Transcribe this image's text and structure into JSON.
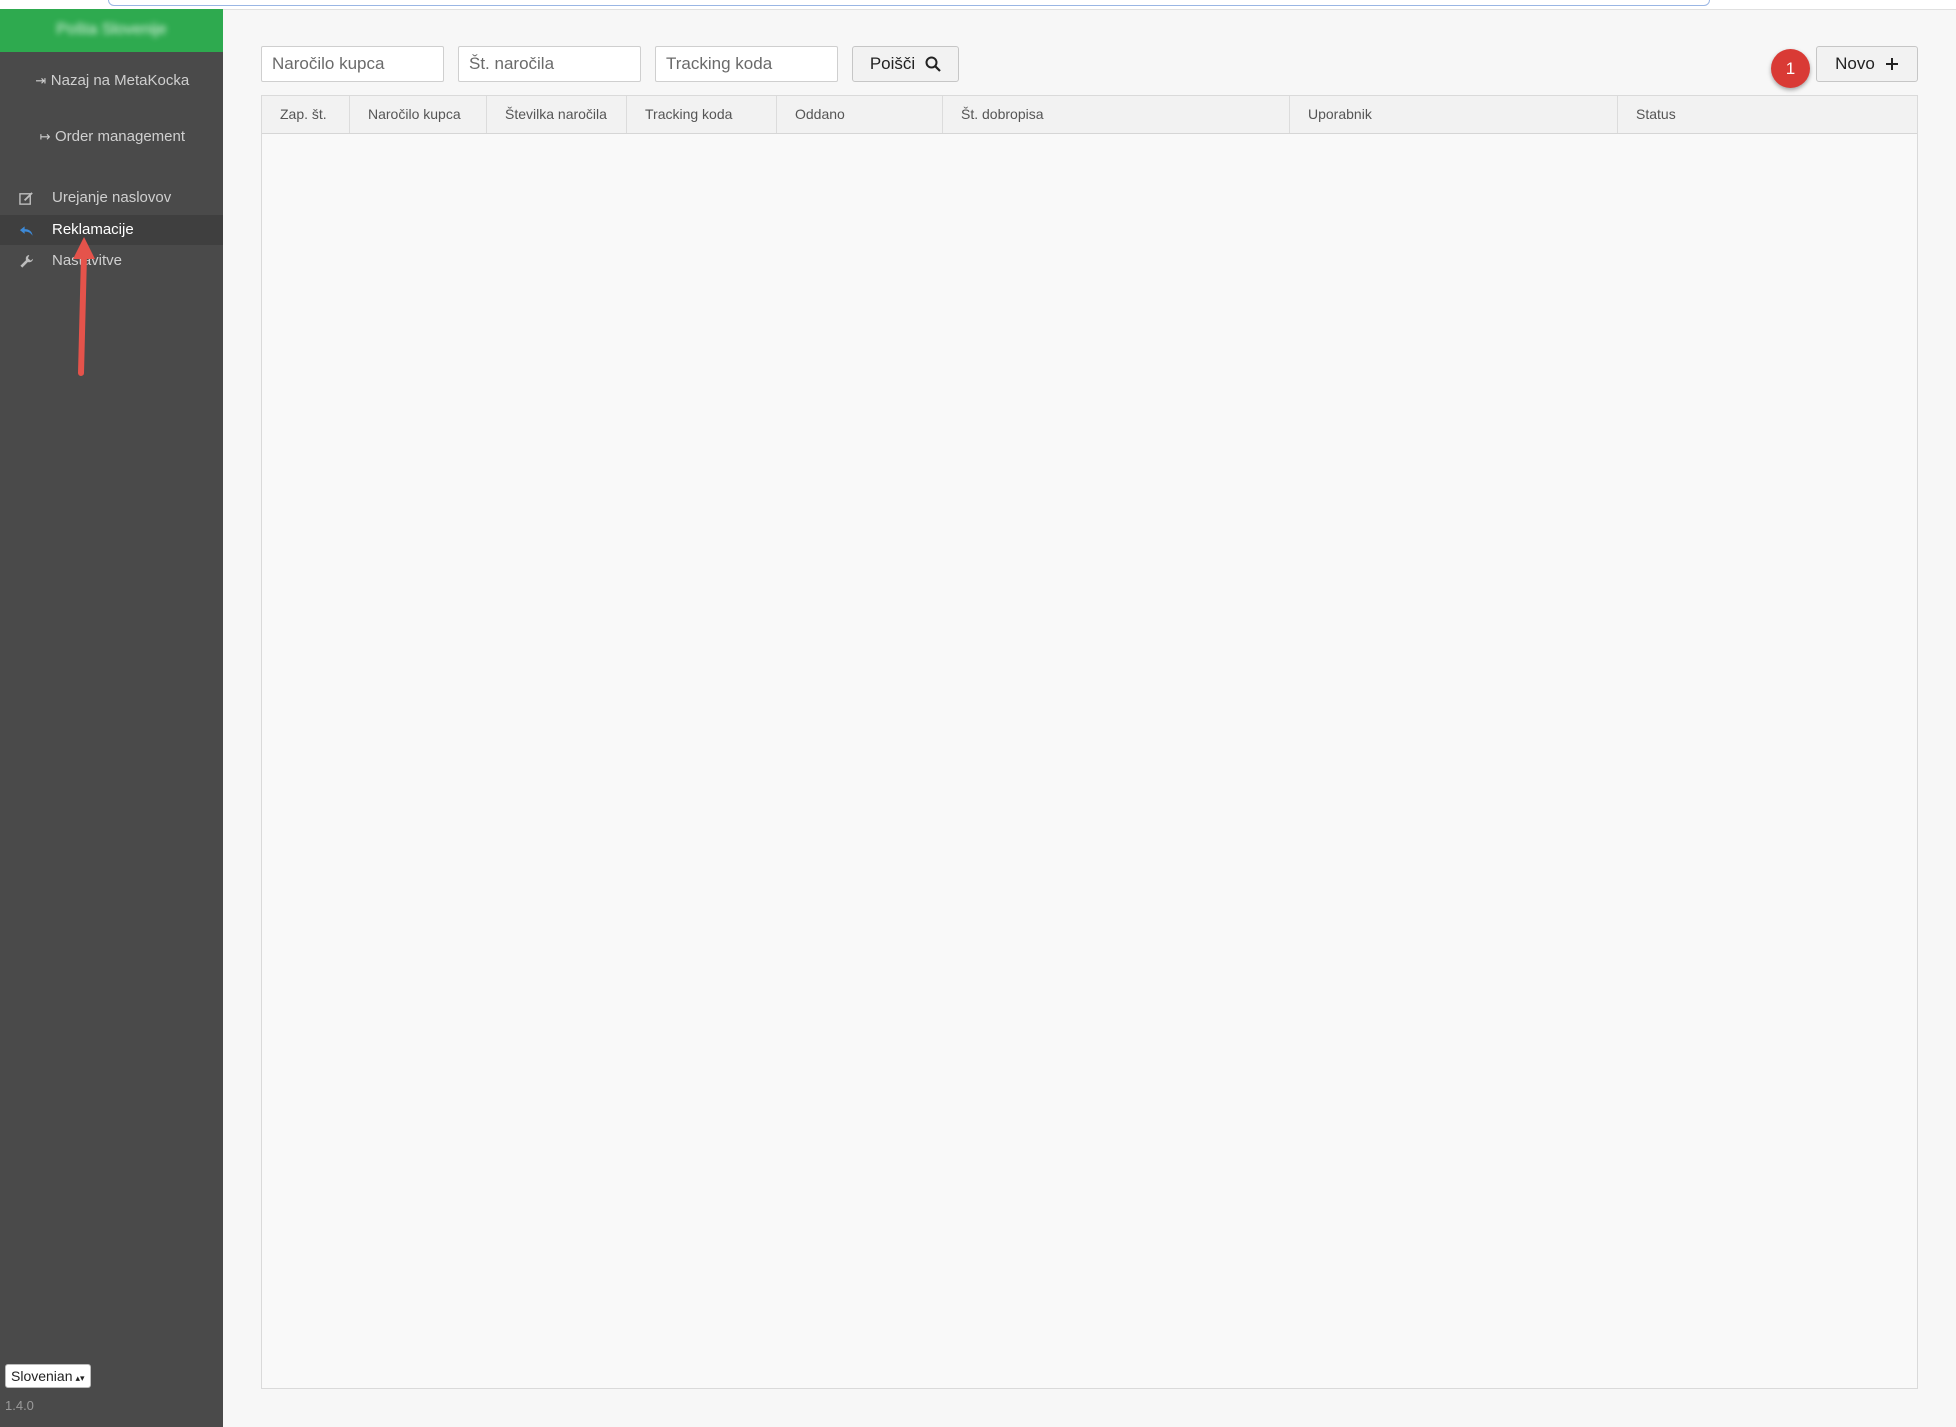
{
  "sidebar": {
    "brand": "Pošta Slovenije",
    "back_link": "Nazaj na MetaKocka",
    "order_link": "Order management",
    "items": [
      {
        "label": "Urejanje naslovov",
        "icon": "edit-icon",
        "active": false
      },
      {
        "label": "Reklamacije",
        "icon": "reply-icon",
        "active": true
      },
      {
        "label": "Nastavitve",
        "icon": "wrench-icon",
        "active": false
      }
    ],
    "language": "Slovenian",
    "version": "1.4.0"
  },
  "search": {
    "customer_order_placeholder": "Naročilo kupca",
    "order_number_placeholder": "Št. naročila",
    "tracking_placeholder": "Tracking koda",
    "search_button": "Poišči"
  },
  "toolbar": {
    "new_button": "Novo",
    "annotation_badge": "1"
  },
  "table": {
    "columns": [
      "Zap. št.",
      "Naročilo kupca",
      "Številka naročila",
      "Tracking koda",
      "Oddano",
      "Št. dobropisa",
      "Uporabnik",
      "Status"
    ],
    "rows": []
  },
  "colors": {
    "brand_green": "#2eaa4f",
    "sidebar_bg": "#4a4a4a",
    "active_icon": "#3d8ad8",
    "annotation_red": "#d93a35",
    "arrow_red": "#e5534b"
  }
}
